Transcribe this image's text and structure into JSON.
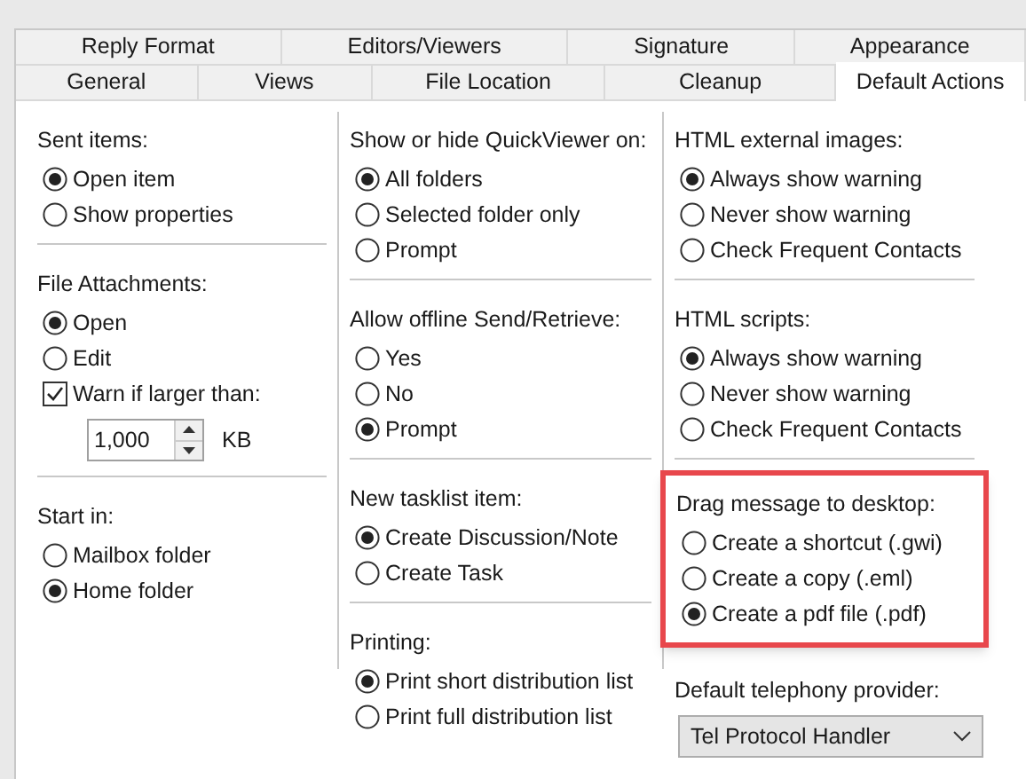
{
  "tab_rows": [
    [
      {
        "label": "Reply Format",
        "selected": false
      },
      {
        "label": "Editors/Viewers",
        "selected": false
      },
      {
        "label": "Signature",
        "selected": false
      },
      {
        "label": "Appearance",
        "selected": false
      }
    ],
    [
      {
        "label": "General",
        "selected": false
      },
      {
        "label": "Views",
        "selected": false
      },
      {
        "label": "File Location",
        "selected": false
      },
      {
        "label": "Cleanup",
        "selected": false
      },
      {
        "label": "Default Actions",
        "selected": true
      }
    ]
  ],
  "columns": [
    [
      {
        "title": "Sent items:",
        "highlighted": false,
        "items": [
          {
            "kind": "radio",
            "label": "Open item",
            "selected": true
          },
          {
            "kind": "radio",
            "label": "Show properties",
            "selected": false
          }
        ]
      },
      {
        "title": "File Attachments:",
        "highlighted": false,
        "items": [
          {
            "kind": "radio",
            "label": "Open",
            "selected": true
          },
          {
            "kind": "radio",
            "label": "Edit",
            "selected": false
          },
          {
            "kind": "checkbox",
            "label": "Warn if larger than:",
            "checked": true
          },
          {
            "kind": "spinner",
            "value": "1,000",
            "unit": "KB"
          }
        ]
      },
      {
        "title": "Start in:",
        "highlighted": false,
        "items": [
          {
            "kind": "radio",
            "label": "Mailbox folder",
            "selected": false
          },
          {
            "kind": "radio",
            "label": "Home folder",
            "selected": true
          }
        ]
      }
    ],
    [
      {
        "title": "Show or hide QuickViewer on:",
        "highlighted": false,
        "items": [
          {
            "kind": "radio",
            "label": "All folders",
            "selected": true
          },
          {
            "kind": "radio",
            "label": "Selected folder only",
            "selected": false
          },
          {
            "kind": "radio",
            "label": "Prompt",
            "selected": false
          }
        ]
      },
      {
        "title": "Allow offline Send/Retrieve:",
        "highlighted": false,
        "items": [
          {
            "kind": "radio",
            "label": "Yes",
            "selected": false
          },
          {
            "kind": "radio",
            "label": "No",
            "selected": false
          },
          {
            "kind": "radio",
            "label": "Prompt",
            "selected": true
          }
        ]
      },
      {
        "title": "New tasklist item:",
        "highlighted": false,
        "items": [
          {
            "kind": "radio",
            "label": "Create Discussion/Note",
            "selected": true
          },
          {
            "kind": "radio",
            "label": "Create Task",
            "selected": false
          }
        ]
      },
      {
        "title": "Printing:",
        "highlighted": false,
        "items": [
          {
            "kind": "radio",
            "label": "Print short distribution list",
            "selected": true
          },
          {
            "kind": "radio",
            "label": "Print full distribution list",
            "selected": false
          }
        ]
      }
    ],
    [
      {
        "title": "HTML external images:",
        "highlighted": false,
        "items": [
          {
            "kind": "radio",
            "label": "Always show warning",
            "selected": true
          },
          {
            "kind": "radio",
            "label": "Never show warning",
            "selected": false
          },
          {
            "kind": "radio",
            "label": "Check Frequent Contacts",
            "selected": false
          }
        ]
      },
      {
        "title": "HTML scripts:",
        "highlighted": false,
        "items": [
          {
            "kind": "radio",
            "label": "Always show warning",
            "selected": true
          },
          {
            "kind": "radio",
            "label": "Never show warning",
            "selected": false
          },
          {
            "kind": "radio",
            "label": "Check Frequent Contacts",
            "selected": false
          }
        ]
      },
      {
        "title": "Drag message to desktop:",
        "highlighted": true,
        "items": [
          {
            "kind": "radio",
            "label": "Create a shortcut (.gwi)",
            "selected": false
          },
          {
            "kind": "radio",
            "label": "Create a copy (.eml)",
            "selected": false
          },
          {
            "kind": "radio",
            "label": "Create a pdf file (.pdf)",
            "selected": true
          }
        ]
      },
      {
        "title": "Default telephony provider:",
        "highlighted": false,
        "items": [
          {
            "kind": "dropdown",
            "value": "Tel Protocol Handler"
          }
        ]
      }
    ]
  ]
}
